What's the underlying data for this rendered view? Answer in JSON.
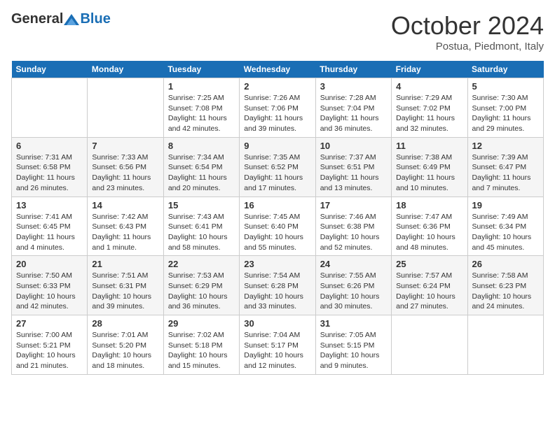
{
  "header": {
    "logo_general": "General",
    "logo_blue": "Blue",
    "title": "October 2024",
    "subtitle": "Postua, Piedmont, Italy"
  },
  "days_of_week": [
    "Sunday",
    "Monday",
    "Tuesday",
    "Wednesday",
    "Thursday",
    "Friday",
    "Saturday"
  ],
  "weeks": [
    [
      {
        "num": "",
        "info": ""
      },
      {
        "num": "",
        "info": ""
      },
      {
        "num": "1",
        "info": "Sunrise: 7:25 AM\nSunset: 7:08 PM\nDaylight: 11 hours and 42 minutes."
      },
      {
        "num": "2",
        "info": "Sunrise: 7:26 AM\nSunset: 7:06 PM\nDaylight: 11 hours and 39 minutes."
      },
      {
        "num": "3",
        "info": "Sunrise: 7:28 AM\nSunset: 7:04 PM\nDaylight: 11 hours and 36 minutes."
      },
      {
        "num": "4",
        "info": "Sunrise: 7:29 AM\nSunset: 7:02 PM\nDaylight: 11 hours and 32 minutes."
      },
      {
        "num": "5",
        "info": "Sunrise: 7:30 AM\nSunset: 7:00 PM\nDaylight: 11 hours and 29 minutes."
      }
    ],
    [
      {
        "num": "6",
        "info": "Sunrise: 7:31 AM\nSunset: 6:58 PM\nDaylight: 11 hours and 26 minutes."
      },
      {
        "num": "7",
        "info": "Sunrise: 7:33 AM\nSunset: 6:56 PM\nDaylight: 11 hours and 23 minutes."
      },
      {
        "num": "8",
        "info": "Sunrise: 7:34 AM\nSunset: 6:54 PM\nDaylight: 11 hours and 20 minutes."
      },
      {
        "num": "9",
        "info": "Sunrise: 7:35 AM\nSunset: 6:52 PM\nDaylight: 11 hours and 17 minutes."
      },
      {
        "num": "10",
        "info": "Sunrise: 7:37 AM\nSunset: 6:51 PM\nDaylight: 11 hours and 13 minutes."
      },
      {
        "num": "11",
        "info": "Sunrise: 7:38 AM\nSunset: 6:49 PM\nDaylight: 11 hours and 10 minutes."
      },
      {
        "num": "12",
        "info": "Sunrise: 7:39 AM\nSunset: 6:47 PM\nDaylight: 11 hours and 7 minutes."
      }
    ],
    [
      {
        "num": "13",
        "info": "Sunrise: 7:41 AM\nSunset: 6:45 PM\nDaylight: 11 hours and 4 minutes."
      },
      {
        "num": "14",
        "info": "Sunrise: 7:42 AM\nSunset: 6:43 PM\nDaylight: 11 hours and 1 minute."
      },
      {
        "num": "15",
        "info": "Sunrise: 7:43 AM\nSunset: 6:41 PM\nDaylight: 10 hours and 58 minutes."
      },
      {
        "num": "16",
        "info": "Sunrise: 7:45 AM\nSunset: 6:40 PM\nDaylight: 10 hours and 55 minutes."
      },
      {
        "num": "17",
        "info": "Sunrise: 7:46 AM\nSunset: 6:38 PM\nDaylight: 10 hours and 52 minutes."
      },
      {
        "num": "18",
        "info": "Sunrise: 7:47 AM\nSunset: 6:36 PM\nDaylight: 10 hours and 48 minutes."
      },
      {
        "num": "19",
        "info": "Sunrise: 7:49 AM\nSunset: 6:34 PM\nDaylight: 10 hours and 45 minutes."
      }
    ],
    [
      {
        "num": "20",
        "info": "Sunrise: 7:50 AM\nSunset: 6:33 PM\nDaylight: 10 hours and 42 minutes."
      },
      {
        "num": "21",
        "info": "Sunrise: 7:51 AM\nSunset: 6:31 PM\nDaylight: 10 hours and 39 minutes."
      },
      {
        "num": "22",
        "info": "Sunrise: 7:53 AM\nSunset: 6:29 PM\nDaylight: 10 hours and 36 minutes."
      },
      {
        "num": "23",
        "info": "Sunrise: 7:54 AM\nSunset: 6:28 PM\nDaylight: 10 hours and 33 minutes."
      },
      {
        "num": "24",
        "info": "Sunrise: 7:55 AM\nSunset: 6:26 PM\nDaylight: 10 hours and 30 minutes."
      },
      {
        "num": "25",
        "info": "Sunrise: 7:57 AM\nSunset: 6:24 PM\nDaylight: 10 hours and 27 minutes."
      },
      {
        "num": "26",
        "info": "Sunrise: 7:58 AM\nSunset: 6:23 PM\nDaylight: 10 hours and 24 minutes."
      }
    ],
    [
      {
        "num": "27",
        "info": "Sunrise: 7:00 AM\nSunset: 5:21 PM\nDaylight: 10 hours and 21 minutes."
      },
      {
        "num": "28",
        "info": "Sunrise: 7:01 AM\nSunset: 5:20 PM\nDaylight: 10 hours and 18 minutes."
      },
      {
        "num": "29",
        "info": "Sunrise: 7:02 AM\nSunset: 5:18 PM\nDaylight: 10 hours and 15 minutes."
      },
      {
        "num": "30",
        "info": "Sunrise: 7:04 AM\nSunset: 5:17 PM\nDaylight: 10 hours and 12 minutes."
      },
      {
        "num": "31",
        "info": "Sunrise: 7:05 AM\nSunset: 5:15 PM\nDaylight: 10 hours and 9 minutes."
      },
      {
        "num": "",
        "info": ""
      },
      {
        "num": "",
        "info": ""
      }
    ]
  ]
}
